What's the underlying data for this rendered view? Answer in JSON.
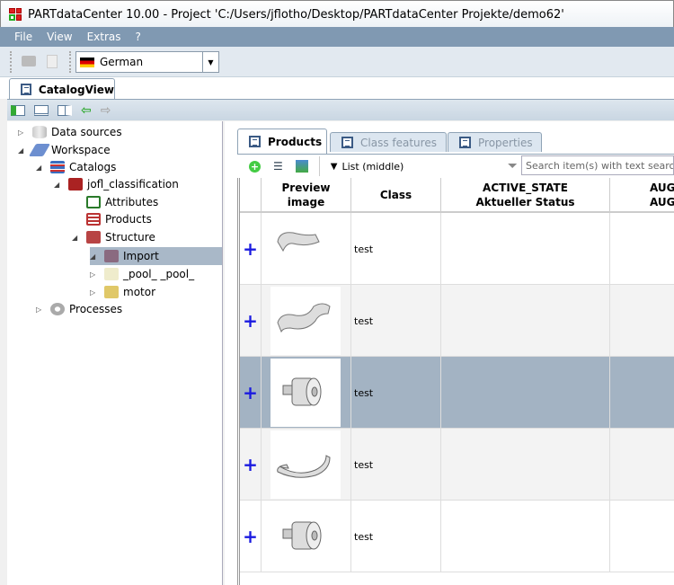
{
  "window": {
    "title": "PARTdataCenter 10.00 - Project 'C:/Users/jflotho/Desktop/PARTdataCenter Projekte/demo62'"
  },
  "menu": [
    "File",
    "View",
    "Extras",
    "?"
  ],
  "toolbar": {
    "language": "German"
  },
  "main_tab": "CatalogView",
  "tree": [
    {
      "label": "Data sources",
      "level": 0,
      "expanded": false,
      "icon": "database-icon"
    },
    {
      "label": "Workspace",
      "level": 0,
      "expanded": true,
      "icon": "workspace-icon"
    },
    {
      "label": "Catalogs",
      "level": 1,
      "expanded": true,
      "icon": "catalogs-icon"
    },
    {
      "label": "jofl_classification",
      "level": 2,
      "expanded": true,
      "icon": "catalog-book-icon"
    },
    {
      "label": "Attributes",
      "level": 3,
      "icon": "attributes-icon"
    },
    {
      "label": "Products",
      "level": 3,
      "icon": "products-icon"
    },
    {
      "label": "Structure",
      "level": 3,
      "expanded": true,
      "icon": "folder-icon"
    },
    {
      "label": "Import",
      "level": 4,
      "expanded": true,
      "selected": true,
      "icon": "folder-icon"
    },
    {
      "label": "_pool_ _pool_",
      "level": 4,
      "expanded": false,
      "icon": "folder-icon"
    },
    {
      "label": "motor",
      "level": 4,
      "expanded": false,
      "icon": "folder-icon"
    },
    {
      "label": "Processes",
      "level": 0,
      "expanded": false,
      "icon": "gear-icon"
    }
  ],
  "panel_tabs": [
    {
      "label": "Products",
      "active": true
    },
    {
      "label": "Class features"
    },
    {
      "label": "Properties"
    }
  ],
  "view_mode": "List (middle)",
  "search": {
    "placeholder": "Search item(s) with text search"
  },
  "columns": [
    "Preview image",
    "Class",
    "ACTIVE_STATE\nAktueller Status",
    "AUGS\nAUGS"
  ],
  "rows": [
    {
      "class": "test",
      "preview": "bent-pipe"
    },
    {
      "class": "test",
      "preview": "curved-pipe"
    },
    {
      "class": "test",
      "preview": "cylinder-fitting",
      "selected": true
    },
    {
      "class": "test",
      "preview": "hook"
    },
    {
      "class": "test",
      "preview": "cylinder-fitting"
    }
  ],
  "colors": {
    "selection": "#a3b3c3",
    "menubar": "#8099b2",
    "add": "#1a1ae0"
  }
}
